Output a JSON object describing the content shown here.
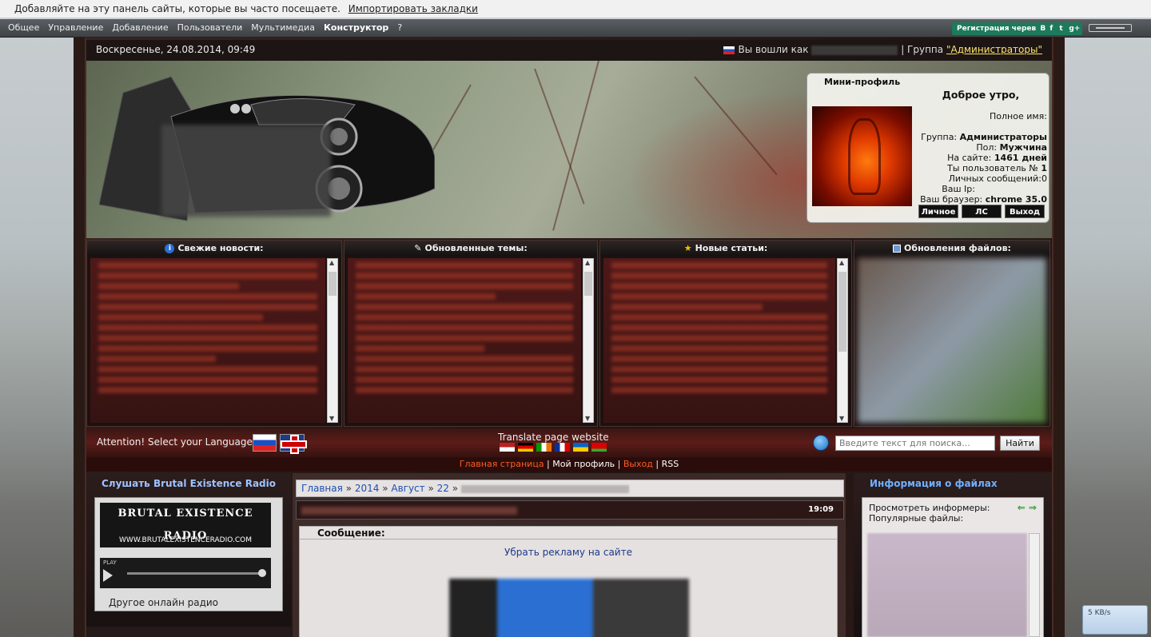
{
  "bookmark_bar": {
    "text": "Добавляйте на эту панель сайты, которые вы часто посещаете.",
    "link": "Импортировать закладки"
  },
  "admin_bar": {
    "menu": [
      "Общее",
      "Управление",
      "Добавление",
      "Пользователи",
      "Мультимедиа",
      "Конструктор",
      "?"
    ],
    "register_text": "Регистрация черев",
    "social": [
      "B",
      "f",
      "t",
      "g+"
    ]
  },
  "topline": {
    "date": "Воскресенье, 24.08.2014, 09:49",
    "logged_prefix": "Вы вошли как",
    "group_prefix": "| Группа",
    "group": "\"Администраторы\""
  },
  "mini_profile": {
    "title": "Мини-профиль",
    "greeting": "Доброе утро,",
    "full_name_label": "Полное имя:",
    "group_label": "Группа:",
    "group": "Администраторы",
    "gender_label": "Пол:",
    "gender": "Мужчина",
    "days_label": "На сайте:",
    "days": "1461 дней",
    "user_no_label": "Ты пользователь №",
    "user_no": "1",
    "messages": "Личных сообщений:0",
    "ip_label": "Ваш Ip:",
    "browser_label": "Ваш браузер:",
    "browser": "chrome 35.0",
    "buttons": [
      "Личное",
      "ЛС",
      "Выход"
    ]
  },
  "blocks": [
    {
      "title": "Свежие новости:",
      "icon": "info-icon"
    },
    {
      "title": "Обновленные темы:",
      "icon": "pencil-icon"
    },
    {
      "title": "Новые статьи:",
      "icon": "star-icon"
    },
    {
      "title": "Обновления файлов:",
      "icon": "disk-icon"
    }
  ],
  "lang_bar": {
    "attention": "Attention! Select your Language -",
    "translate": "Translate page website",
    "search_placeholder": "Введите текст для поиска...",
    "search_button": "Найти"
  },
  "nav": {
    "home": "Главная страница",
    "profile": "Мой профиль",
    "logout": "Выход",
    "rss": "RSS"
  },
  "left": {
    "radio_title": "Слушать Brutal Existence Radio",
    "radio_logo": "BRUTAL EXISTENCE RADIO",
    "radio_url": "WWW.BRUTALEXISTENCERADIO.COM",
    "play_label": "PLAY",
    "other_radio": "Другое онлайн радио"
  },
  "center": {
    "crumbs": [
      "Главная",
      "2014",
      "Август",
      "22"
    ],
    "time": "19:09",
    "message_label": "Сообщение:",
    "ad_link": "Убрать рекламу на сайте"
  },
  "right": {
    "title": "Информация о файлах",
    "informers": "Просмотреть информеры:",
    "popular": "Популярные файлы:"
  },
  "speed_meter": {
    "value": "5 KB/s"
  }
}
